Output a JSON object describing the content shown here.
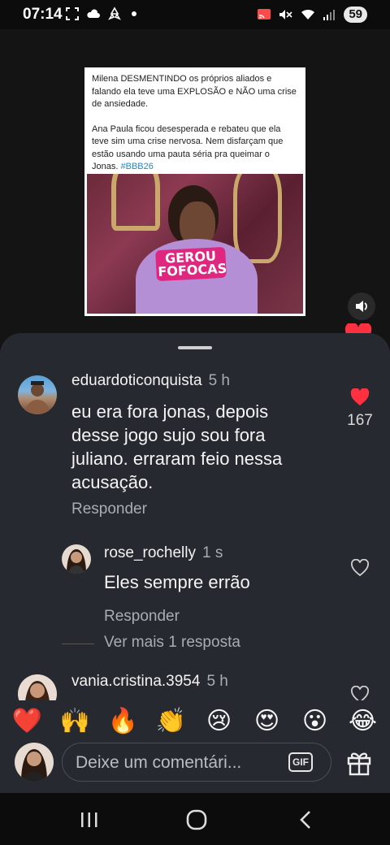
{
  "status_bar": {
    "time": "07:14",
    "battery": "59",
    "icons_left": [
      "screenshot-icon",
      "cloud-icon",
      "recycle-icon",
      "dot-icon"
    ],
    "icons_right": [
      "cast-icon",
      "mute-icon",
      "wifi-icon",
      "signal-icon"
    ]
  },
  "post": {
    "paragraph1": "Milena DESMENTINDO os próprios aliados e falando ela teve uma EXPLOSÃO e NÃO uma crise de ansiedade.",
    "paragraph2": "Ana Paula ficou desesperada e rebateu que ela teve sim uma crise nervosa. Nem disfarçam que estão usando uma pauta séria pra queimar o Jonas.",
    "hashtag": "#BBB26",
    "image_logo": "GEROU\nFOFOCAS"
  },
  "comments": [
    {
      "username": "eduardoticonquista",
      "time": "5 h",
      "text": "eu era fora jonas, depois desse jogo sujo sou fora juliano. erraram feio nessa acusação.",
      "reply_label": "Responder",
      "likes": "167",
      "liked": true
    },
    {
      "username": "rose_rochelly",
      "time": "1 s",
      "text": "Eles sempre errão",
      "reply_label": "Responder",
      "liked": false
    },
    {
      "username": "vania.cristina.3954",
      "time": "5 h"
    }
  ],
  "view_more_replies": "Ver mais 1 resposta",
  "emoji_bar": [
    "❤️",
    "🙌",
    "🔥",
    "👏",
    "😢",
    "😍",
    "😮",
    "😂"
  ],
  "input": {
    "placeholder": "Deixe um comentári...",
    "gif_label": "GIF"
  },
  "colors": {
    "sheet_bg": "#262a30",
    "like_red": "#ff3040",
    "hashtag_blue": "#1a8ad6",
    "secondary_text": "#a9adb2"
  }
}
